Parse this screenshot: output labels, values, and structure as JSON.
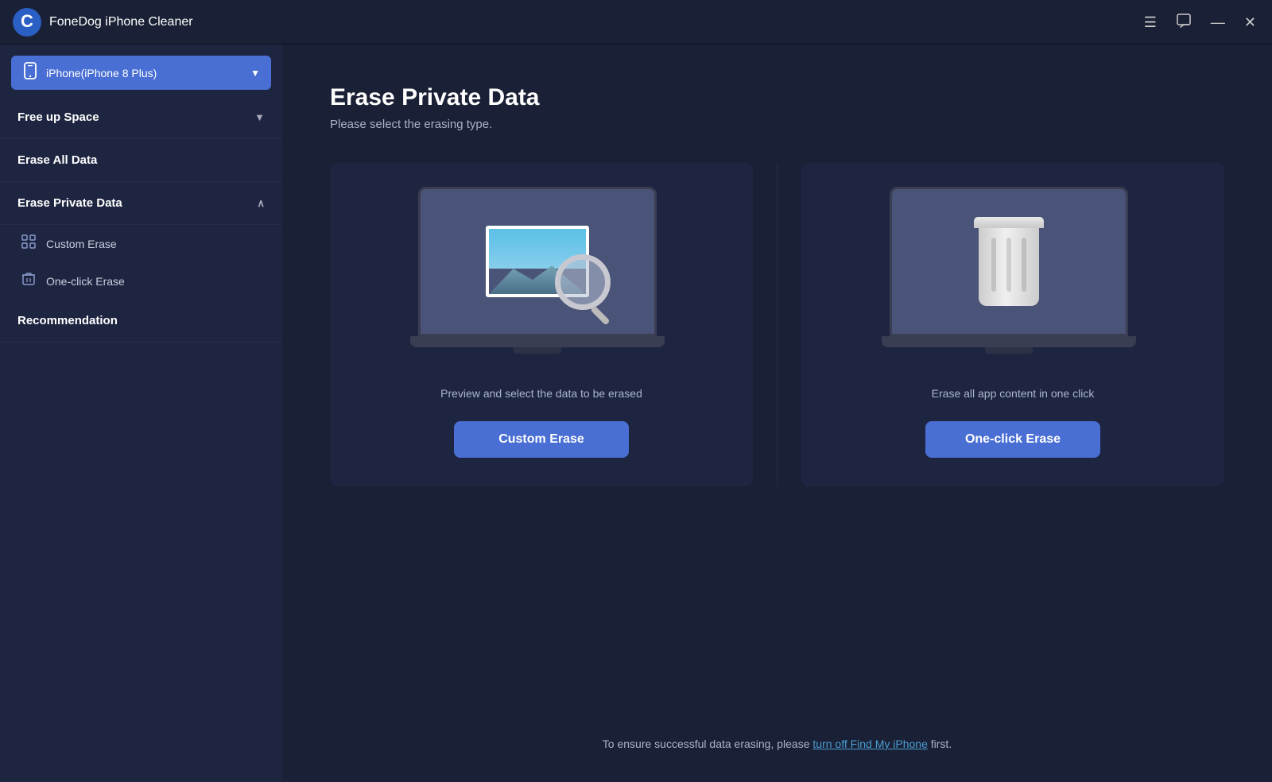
{
  "titleBar": {
    "appName": "FoneDog iPhone Cleaner",
    "controls": {
      "menu": "☰",
      "chat": "💬",
      "minimize": "—",
      "close": "✕"
    }
  },
  "sidebar": {
    "device": {
      "name": "iPhone(iPhone 8 Plus)",
      "chevron": "▼"
    },
    "sections": [
      {
        "id": "free-up-space",
        "label": "Free up Space",
        "expanded": false,
        "hasArrow": true,
        "arrowDown": true
      },
      {
        "id": "erase-all-data",
        "label": "Erase All Data",
        "expanded": false,
        "hasArrow": false
      },
      {
        "id": "erase-private-data",
        "label": "Erase Private Data",
        "expanded": true,
        "hasArrow": true,
        "arrowDown": false,
        "children": [
          {
            "id": "custom-erase",
            "label": "Custom Erase",
            "icon": "grid"
          },
          {
            "id": "one-click-erase",
            "label": "One-click Erase",
            "icon": "trash"
          }
        ]
      },
      {
        "id": "recommendation",
        "label": "Recommendation",
        "expanded": false,
        "hasArrow": false
      }
    ]
  },
  "content": {
    "pageTitle": "Erase Private Data",
    "pageSubtitle": "Please select the erasing type.",
    "cards": [
      {
        "id": "custom-erase-card",
        "description": "Preview and select the data to be erased",
        "buttonLabel": "Custom Erase"
      },
      {
        "id": "one-click-erase-card",
        "description": "Erase all app content in one click",
        "buttonLabel": "One-click Erase"
      }
    ],
    "bottomNote": {
      "text1": "To ensure successful data erasing, please ",
      "linkText": "turn off Find My iPhone",
      "text2": " first."
    }
  }
}
